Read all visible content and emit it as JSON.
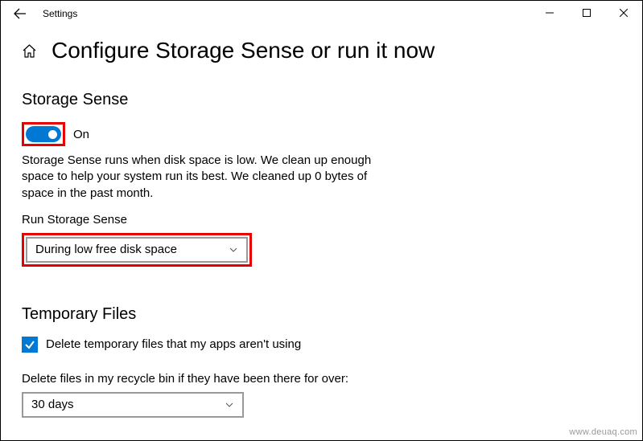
{
  "window": {
    "title": "Settings"
  },
  "page": {
    "title": "Configure Storage Sense or run it now"
  },
  "storage_sense": {
    "section_title": "Storage Sense",
    "toggle_state": "On",
    "description": "Storage Sense runs when disk space is low. We clean up enough space to help your system run its best. We cleaned up 0 bytes of space in the past month.",
    "run_label": "Run Storage Sense",
    "run_selected": "During low free disk space"
  },
  "temp_files": {
    "section_title": "Temporary Files",
    "checkbox_label": "Delete temporary files that my apps aren't using",
    "recycle_label": "Delete files in my recycle bin if they have been there for over:",
    "recycle_selected": "30 days"
  },
  "watermark": "www.deuaq.com"
}
